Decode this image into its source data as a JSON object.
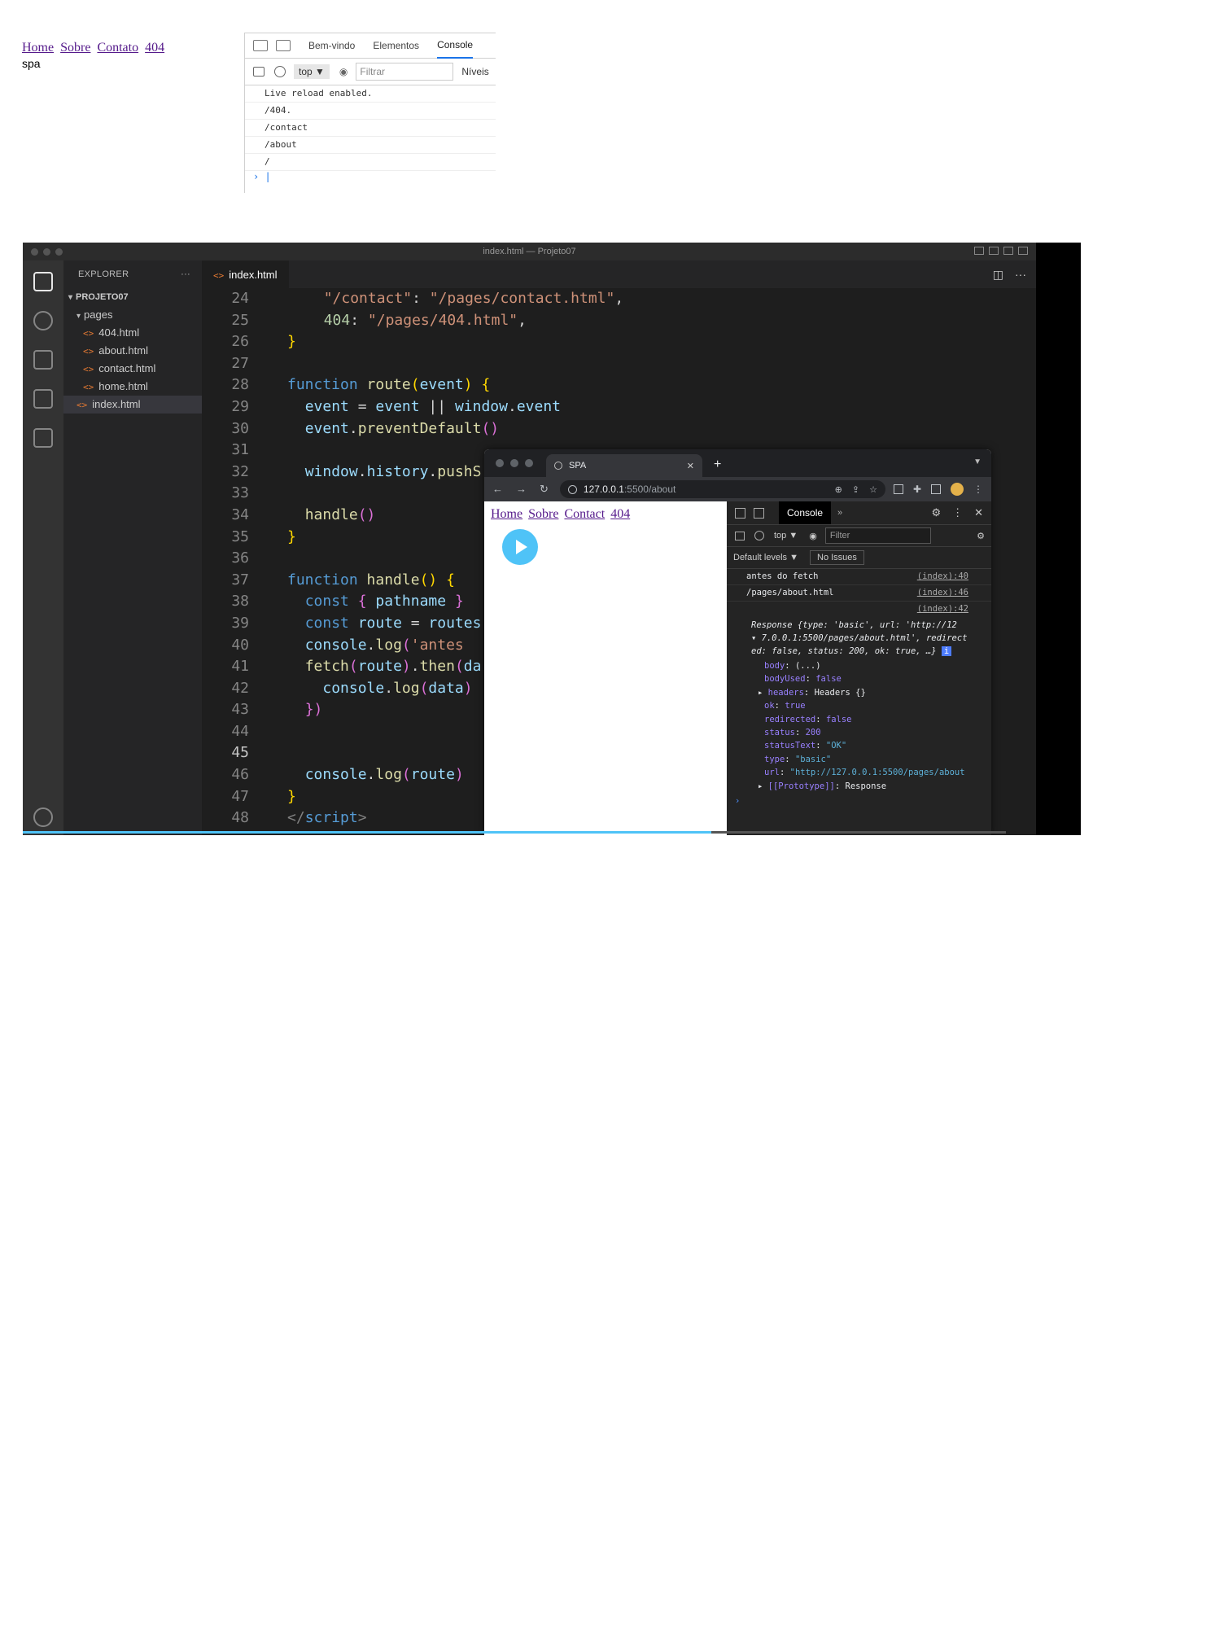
{
  "top_page": {
    "links": [
      "Home",
      "Sobre",
      "Contato",
      "404"
    ],
    "text": "spa"
  },
  "top_devtools": {
    "tabs": [
      "Bem-vindo",
      "Elementos",
      "Console"
    ],
    "context": "top",
    "filter_placeholder": "Filtrar",
    "levels": "Níveis",
    "logs": [
      "Live reload enabled.",
      "/404.",
      "/contact",
      "/about",
      "/"
    ]
  },
  "vscode": {
    "window_title": "index.html — Projeto07",
    "explorer_title": "EXPLORER",
    "project": "PROJETO07",
    "folder": "pages",
    "files": [
      "404.html",
      "about.html",
      "contact.html",
      "home.html"
    ],
    "root_file": "index.html",
    "active_tab": "index.html",
    "current_line": 45,
    "code_lines": [
      {
        "n": 24,
        "html": "  <span class=\"s\">\"/contact\"</span>: <span class=\"s\">\"/pages/contact.html\"</span>,"
      },
      {
        "n": 25,
        "html": "  <span class=\"n\">404</span>: <span class=\"s\">\"/pages/404.html\"</span>,"
      },
      {
        "n": 26,
        "html": "<span class=\"y\">}</span>"
      },
      {
        "n": 27,
        "html": ""
      },
      {
        "n": 28,
        "html": "<span class=\"k\">function</span> <span class=\"f\">route</span><span class=\"y\">(</span><span class=\"v\">event</span><span class=\"y\">)</span> <span class=\"y\">{</span>"
      },
      {
        "n": 29,
        "html": "  <span class=\"v\">event</span> = <span class=\"v\">event</span> || <span class=\"v\">window</span>.<span class=\"v\">event</span>"
      },
      {
        "n": 30,
        "html": "  <span class=\"v\">event</span>.<span class=\"f\">preventDefault</span><span class=\"p\">()</span>"
      },
      {
        "n": 31,
        "html": ""
      },
      {
        "n": 32,
        "html": "  <span class=\"v\">window</span>.<span class=\"v\">history</span>.<span class=\"f\">pushS</span>"
      },
      {
        "n": 33,
        "html": ""
      },
      {
        "n": 34,
        "html": "  <span class=\"f\">handle</span><span class=\"p\">()</span>"
      },
      {
        "n": 35,
        "html": "<span class=\"y\">}</span>"
      },
      {
        "n": 36,
        "html": ""
      },
      {
        "n": 37,
        "html": "<span class=\"k\">function</span> <span class=\"f\">handle</span><span class=\"y\">()</span> <span class=\"y\">{</span>"
      },
      {
        "n": 38,
        "html": "  <span class=\"k\">const</span> <span class=\"p\">{</span> <span class=\"v\">pathname</span> <span class=\"p\">}</span>"
      },
      {
        "n": 39,
        "html": "  <span class=\"k\">const</span> <span class=\"v\">route</span> = <span class=\"v\">routes</span>"
      },
      {
        "n": 40,
        "html": "  <span class=\"v\">console</span>.<span class=\"f\">log</span><span class=\"p\">(</span><span class=\"s\">'antes </span>"
      },
      {
        "n": 41,
        "html": "  <span class=\"f\">fetch</span><span class=\"p\">(</span><span class=\"v\">route</span><span class=\"p\">)</span>.<span class=\"f\">then</span><span class=\"p\">(</span><span class=\"v\">da</span>"
      },
      {
        "n": 42,
        "html": "    <span class=\"v\">console</span>.<span class=\"f\">log</span><span class=\"p\">(</span><span class=\"v\">data</span><span class=\"p\">)</span>"
      },
      {
        "n": 43,
        "html": "  <span class=\"p\">})</span>"
      },
      {
        "n": 44,
        "html": ""
      },
      {
        "n": 45,
        "html": ""
      },
      {
        "n": 46,
        "html": "  <span class=\"v\">console</span>.<span class=\"f\">log</span><span class=\"p\">(</span><span class=\"v\">route</span><span class=\"p\">)</span>"
      },
      {
        "n": 47,
        "html": "<span class=\"y\">}</span>"
      },
      {
        "n": 48,
        "html": "<span class=\"t\">&lt;/</span><span class=\"k\">script</span><span class=\"t\">&gt;</span>"
      }
    ]
  },
  "browser": {
    "tab_title": "SPA",
    "url_host": "127.0.0.1",
    "url_path": ":5500/about",
    "links": [
      "Home",
      "Sobre",
      "Contact",
      "404"
    ],
    "devtools": {
      "tab": "Console",
      "context": "top",
      "filter_placeholder": "Filter",
      "levels": "Default levels",
      "issues": "No Issues",
      "messages": [
        {
          "text": "antes do fetch",
          "src": "(index):40"
        },
        {
          "text": "/pages/about.html",
          "src": "(index):46"
        }
      ],
      "response_src": "(index):42",
      "response_header_1": "Response {type: 'basic', url: 'http://12",
      "response_header_2": "7.0.0.1:5500/pages/about.html', redirect",
      "response_header_3": "ed: false, status: 200, ok: true, …}",
      "props": [
        {
          "k": "body",
          "v": "(...)",
          "cls": ""
        },
        {
          "k": "bodyUsed",
          "v": "false",
          "cls": "bv"
        },
        {
          "k": "headers",
          "v": "Headers {}",
          "cls": ""
        },
        {
          "k": "ok",
          "v": "true",
          "cls": "bv"
        },
        {
          "k": "redirected",
          "v": "false",
          "cls": "bv"
        },
        {
          "k": "status",
          "v": "200",
          "cls": "bv"
        },
        {
          "k": "statusText",
          "v": "\"OK\"",
          "cls": "sv"
        },
        {
          "k": "type",
          "v": "\"basic\"",
          "cls": "sv"
        },
        {
          "k": "url",
          "v": "\"http://127.0.0.1:5500/pages/about",
          "cls": "sv"
        },
        {
          "k": "[[Prototype]]",
          "v": "Response",
          "cls": ""
        }
      ]
    }
  },
  "video_progress": 0.7
}
